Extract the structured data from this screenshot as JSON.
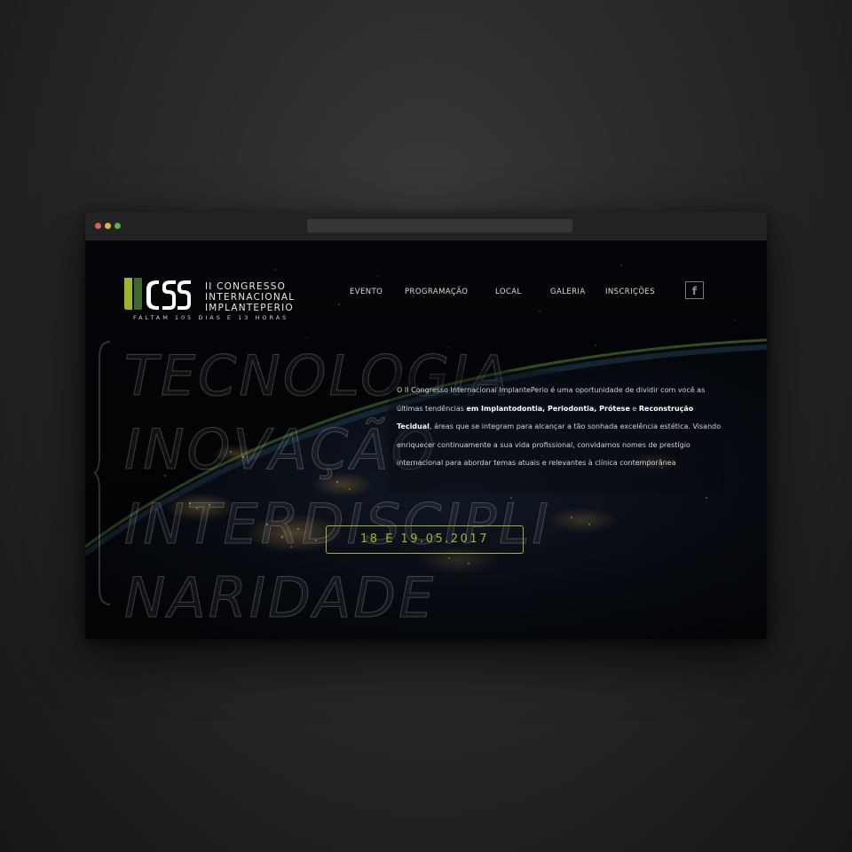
{
  "brand": {
    "line1": "II CONGRESSO",
    "line2": "INTERNACIONAL",
    "line3": "IMPLANTEPERIO",
    "countdown": "FALTAM 105 DIAS E 13 HORAS",
    "colors": {
      "green": "#9cb52c",
      "dark_green": "#3f6b2a",
      "white": "#ffffff"
    }
  },
  "nav": {
    "items": [
      "EVENTO",
      "PROGRAMAÇÃO",
      "LOCAL",
      "GALERIA",
      "INSCRIÇÕES"
    ],
    "facebook_icon": "facebook-icon",
    "facebook_glyph": "f"
  },
  "hero": {
    "words": [
      "TECNOLOGIA",
      "INOVAÇÃO",
      "INTERDISCIPLI",
      "NARIDADE"
    ],
    "intro": {
      "part1": "O II Congresso Internacional ImplantePerio é uma oportunidade de dividir com você as últimas tendências ",
      "bold1": "em Implantodontia, Periodontia, Prótese",
      "part2": " e ",
      "bold2": "Reconstrução Tecidual",
      "part3": ", áreas que se integram para alcançar a tão sonhada excelência estética. Visando enriquecer continuamente a sua vida profissional, convidamos nomes de prestígio internacional para abordar temas atuais e relevantes à clínica contemporânea"
    },
    "date": "18 E 19.05.2017"
  },
  "accent_color": "#9cb52c"
}
